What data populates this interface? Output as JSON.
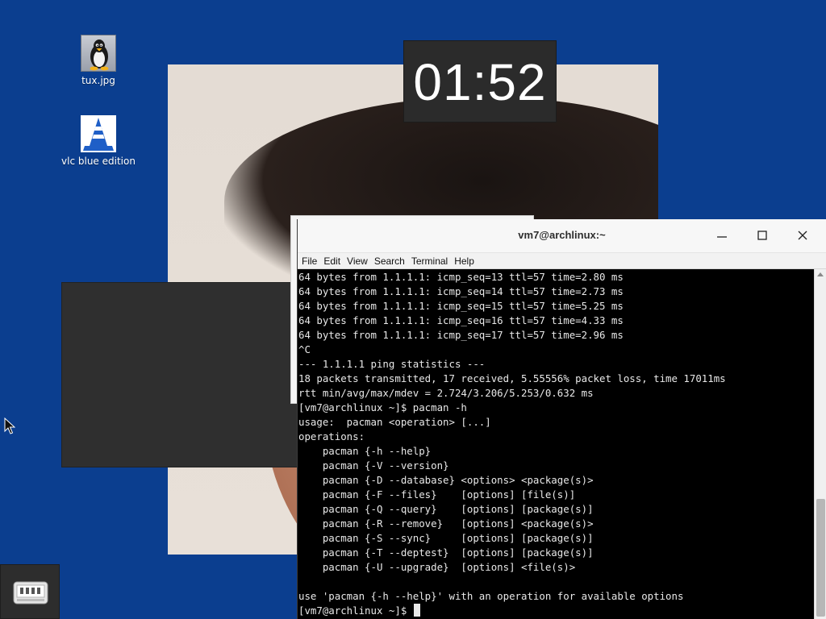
{
  "desktop": {
    "icons": [
      {
        "label": "tux.jpg",
        "icon": "tux-penguin-icon"
      },
      {
        "label": "vlc blue edition",
        "icon": "vlc-cone-icon"
      }
    ],
    "background_color": "#0b3e8f"
  },
  "clock": {
    "time": "01:52"
  },
  "terminal": {
    "title": "vm7@archlinux:~",
    "menu": [
      "File",
      "Edit",
      "View",
      "Search",
      "Terminal",
      "Help"
    ],
    "window_buttons": [
      "minimize-icon",
      "maximize-icon",
      "close-icon"
    ],
    "lines": [
      "64 bytes from 1.1.1.1: icmp_seq=13 ttl=57 time=2.80 ms",
      "64 bytes from 1.1.1.1: icmp_seq=14 ttl=57 time=2.73 ms",
      "64 bytes from 1.1.1.1: icmp_seq=15 ttl=57 time=5.25 ms",
      "64 bytes from 1.1.1.1: icmp_seq=16 ttl=57 time=4.33 ms",
      "64 bytes from 1.1.1.1: icmp_seq=17 ttl=57 time=2.96 ms",
      "^C",
      "--- 1.1.1.1 ping statistics ---",
      "18 packets transmitted, 17 received, 5.55556% packet loss, time 17011ms",
      "rtt min/avg/max/mdev = 2.724/3.206/5.253/0.632 ms",
      "[vm7@archlinux ~]$ pacman -h",
      "usage:  pacman <operation> [...]",
      "operations:",
      "    pacman {-h --help}",
      "    pacman {-V --version}",
      "    pacman {-D --database} <options> <package(s)>",
      "    pacman {-F --files}    [options] [file(s)]",
      "    pacman {-Q --query}    [options] [package(s)]",
      "    pacman {-R --remove}   [options] <package(s)>",
      "    pacman {-S --sync}     [options] [package(s)]",
      "    pacman {-T --deptest}  [options] [package(s)]",
      "    pacman {-U --upgrade}  [options] <file(s)>",
      "",
      "use 'pacman {-h --help}' with an operation for available options"
    ],
    "prompt": "[vm7@archlinux ~]$ "
  },
  "taskbar": {
    "launcher_icon": "app-launcher-icon"
  }
}
